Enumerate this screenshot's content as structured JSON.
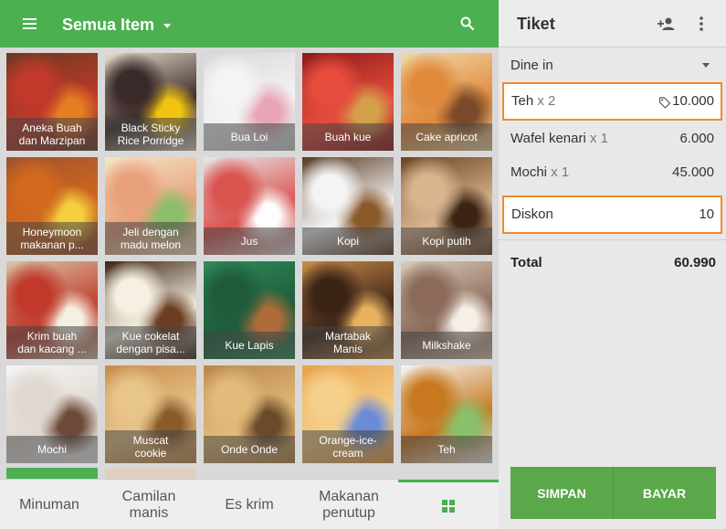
{
  "header": {
    "category_label": "Semua Item",
    "menu_icon": "menu-icon",
    "search_icon": "search-icon"
  },
  "items": [
    {
      "name_lines": [
        "Aneka Buah",
        "dan Marzipan"
      ],
      "colors": [
        "#6b3a1f",
        "#c0392b",
        "#e67e22"
      ]
    },
    {
      "name_lines": [
        "Black Sticky",
        "Rice Porridge"
      ],
      "colors": [
        "#e9dcc9",
        "#3b2a2a",
        "#f1c40f"
      ]
    },
    {
      "name_lines": [
        "Bua Loi"
      ],
      "colors": [
        "#d8d8d8",
        "#f4f4f4",
        "#e8a5b5"
      ]
    },
    {
      "name_lines": [
        "Buah kue"
      ],
      "colors": [
        "#8b1a1a",
        "#e74c3c",
        "#d4a04a"
      ]
    },
    {
      "name_lines": [
        "Cake apricot"
      ],
      "colors": [
        "#f0d9a8",
        "#e08a3c",
        "#7a4a2a"
      ]
    },
    {
      "name_lines": [
        "Honeymoon",
        "makanan p..."
      ],
      "colors": [
        "#a0522d",
        "#d2691e",
        "#f4d03f"
      ]
    },
    {
      "name_lines": [
        "Jeli dengan",
        "madu melon"
      ],
      "colors": [
        "#f5e6c8",
        "#e8a07a",
        "#8bbf6a"
      ]
    },
    {
      "name_lines": [
        "Jus"
      ],
      "colors": [
        "#e8e8e8",
        "#d9534f",
        "#fdfdfd"
      ]
    },
    {
      "name_lines": [
        "Kopi"
      ],
      "colors": [
        "#5a3a22",
        "#f4f4f4",
        "#8b5a2b"
      ]
    },
    {
      "name_lines": [
        "Kopi putih"
      ],
      "colors": [
        "#6b4423",
        "#d9b48f",
        "#3b2414"
      ]
    },
    {
      "name_lines": [
        "Krim buah",
        "dan kacang ..."
      ],
      "colors": [
        "#d7c5a8",
        "#c0392b",
        "#f5f0e1"
      ]
    },
    {
      "name_lines": [
        "Kue cokelat",
        "dengan pisa..."
      ],
      "colors": [
        "#3b2314",
        "#f5f0e1",
        "#6b3e22"
      ]
    },
    {
      "name_lines": [
        "Kue Lapis"
      ],
      "colors": [
        "#2e8b57",
        "#1e5b3a",
        "#b06b3a"
      ]
    },
    {
      "name_lines": [
        "Martabak",
        "Manis"
      ],
      "colors": [
        "#c98c4a",
        "#3b2416",
        "#e8b15f"
      ]
    },
    {
      "name_lines": [
        "Milkshake"
      ],
      "colors": [
        "#d9cbb8",
        "#8b6a5a",
        "#f5efe6"
      ]
    },
    {
      "name_lines": [
        "Mochi"
      ],
      "colors": [
        "#f5f5f5",
        "#e0d8d0",
        "#6b4a3a"
      ]
    },
    {
      "name_lines": [
        "Muscat",
        "cookie"
      ],
      "colors": [
        "#c88a4a",
        "#e8c58a",
        "#8b5a2b"
      ]
    },
    {
      "name_lines": [
        "Onde Onde"
      ],
      "colors": [
        "#b8864a",
        "#e2bb7a",
        "#6b4a2a"
      ]
    },
    {
      "name_lines": [
        "Orange-ice-",
        "cream"
      ],
      "colors": [
        "#e8a04a",
        "#f5d08a",
        "#6b8bd9"
      ]
    },
    {
      "name_lines": [
        "Teh"
      ],
      "colors": [
        "#f5f5f5",
        "#c8781e",
        "#8bbf6a"
      ]
    }
  ],
  "partial_tiles": [
    {
      "color": "#4caf50"
    },
    {
      "color": "#e0d0c0"
    }
  ],
  "categories": [
    {
      "label": "Minuman"
    },
    {
      "label": "Camilan manis"
    },
    {
      "label": "Es krim"
    },
    {
      "label": "Makanan penutup"
    },
    {
      "label": "",
      "icon": "grid-icon"
    }
  ],
  "ticket": {
    "title": "Tiket",
    "add_customer_icon": "add-customer-icon",
    "more_icon": "more-vert-icon",
    "dining_option": "Dine in",
    "lines": [
      {
        "name": "Teh",
        "qty": "x 2",
        "amount": "10.000",
        "highlighted": true,
        "has_discount": true
      },
      {
        "name": "Wafel kenari",
        "qty": "x 1",
        "amount": "6.000",
        "highlighted": false
      },
      {
        "name": "Mochi",
        "qty": "x 1",
        "amount": "45.000",
        "highlighted": false
      },
      {
        "name": "Diskon",
        "qty": "",
        "amount": "10",
        "highlighted": true
      }
    ],
    "total_label": "Total",
    "total_amount": "60.990",
    "save_label": "SIMPAN",
    "pay_label": "BAYAR"
  },
  "colors": {
    "accent": "#4caf50",
    "highlight_border": "#f08a2c"
  }
}
